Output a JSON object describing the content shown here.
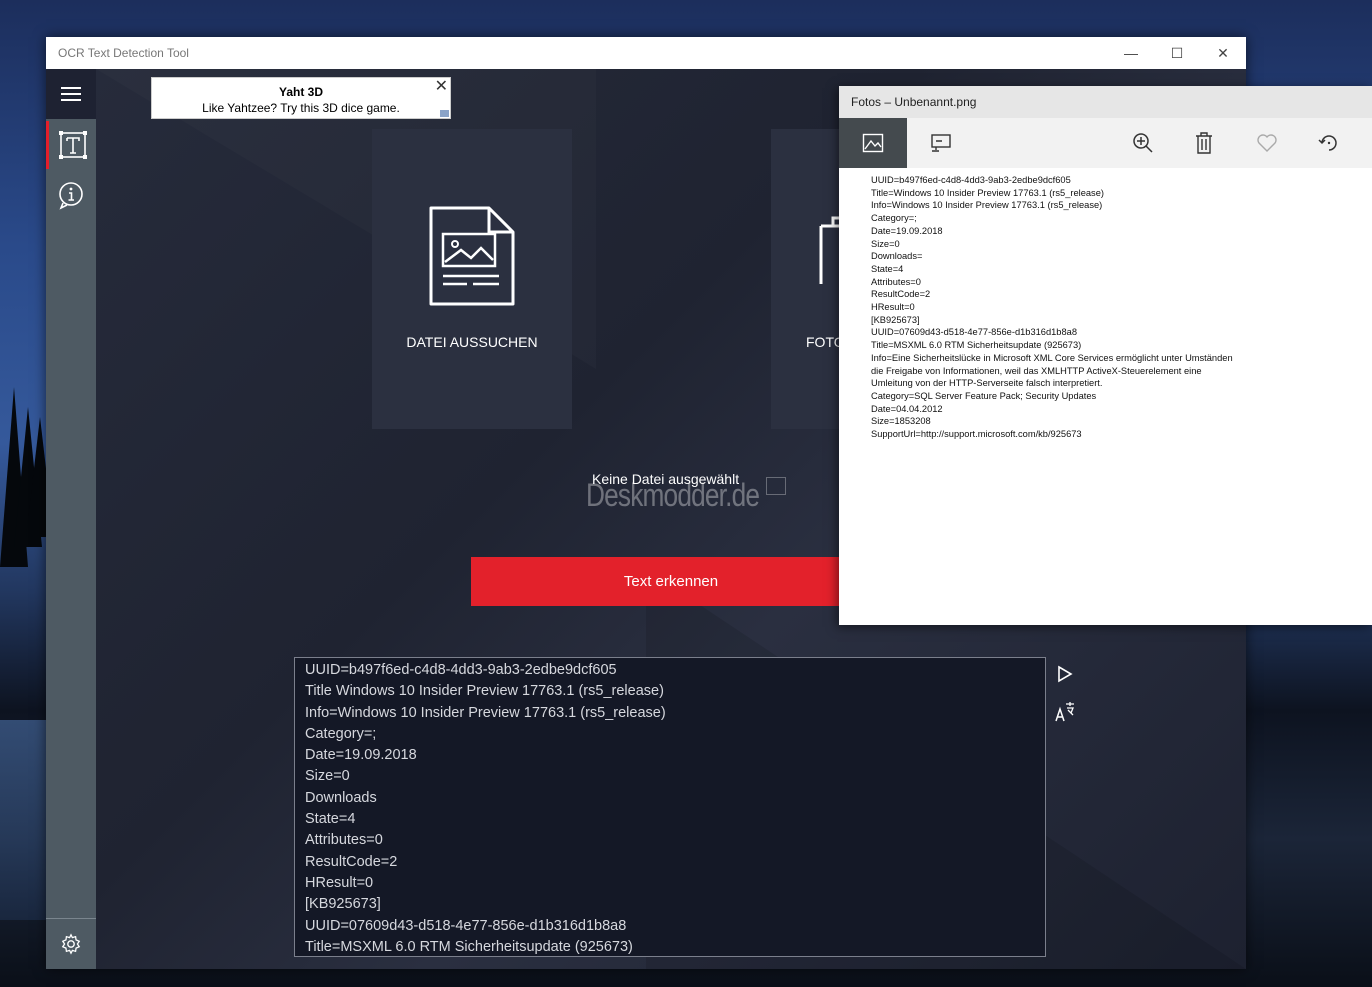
{
  "window": {
    "title": "OCR Text Detection Tool",
    "controls": {
      "minimize": "—",
      "maximize": "☐",
      "close": "✕"
    }
  },
  "ad": {
    "title": "Yaht 3D",
    "text": "Like Yahtzee? Try this 3D dice game.",
    "close": "✕"
  },
  "nav": {
    "menu_icon": "hamburger-icon",
    "ocr_icon": "text-frame-icon",
    "info_icon": "info-icon",
    "settings_icon": "gear-icon"
  },
  "tiles": {
    "select_file_label": "DATEI AUSSUCHEN",
    "photo_label": "FOTO"
  },
  "status": {
    "no_file": "Keine Datei ausgewählt",
    "watermark": "Deskmodder.de"
  },
  "recognize_button": "Text erkennen",
  "output_lines": [
    "UUID=b497f6ed-c4d8-4dd3-9ab3-2edbe9dcf605",
    "Title Windows 10 Insider Preview 17763.1 (rs5_release)",
    "Info=Windows 10 Insider Preview 17763.1 (rs5_release)",
    "Category=;",
    "Date=19.09.2018",
    "Size=0",
    "Downloads",
    "State=4",
    "Attributes=0",
    "ResultCode=2",
    "HResult=0",
    "[KB925673]",
    "UUID=07609d43-d518-4e77-856e-d1b316d1b8a8",
    "Title=MSXML 6.0 RTM Sicherheitsupdate (925673)"
  ],
  "output_actions": {
    "play_icon": "play-icon",
    "translate_icon": "translate-icon"
  },
  "fotos": {
    "title": "Fotos – Unbenannt.png",
    "tools": [
      "image-icon",
      "slideshow-icon",
      "zoom-icon",
      "delete-icon",
      "heart-icon",
      "rotate-icon"
    ],
    "lines": [
      "UUID=b497f6ed-c4d8-4dd3-9ab3-2edbe9dcf605",
      "Title=Windows 10 Insider Preview 17763.1 (rs5_release)",
      "Info=Windows 10 Insider Preview 17763.1 (rs5_release)",
      "Category=;",
      "Date=19.09.2018",
      "Size=0",
      "Downloads=",
      "State=4",
      "Attributes=0",
      "ResultCode=2",
      "HResult=0",
      "[KB925673]",
      "UUID=07609d43-d518-4e77-856e-d1b316d1b8a8",
      "Title=MSXML 6.0 RTM Sicherheitsupdate  (925673)",
      "Info=Eine Sicherheitslücke in Microsoft XML Core Services ermöglicht unter Umständen",
      "die Freigabe von Informationen, weil das XMLHTTP ActiveX-Steuerelement eine",
      "Umleitung von der HTTP-Serverseite falsch interpretiert.",
      "Category=SQL Server Feature Pack; Security Updates",
      "Date=04.04.2012",
      "Size=1853208",
      "SupportUrl=http://support.microsoft.com/kb/925673"
    ]
  },
  "colors": {
    "accent": "#e3212b",
    "sidebar": "#4e5a63",
    "content_bg": "#1e2232"
  }
}
